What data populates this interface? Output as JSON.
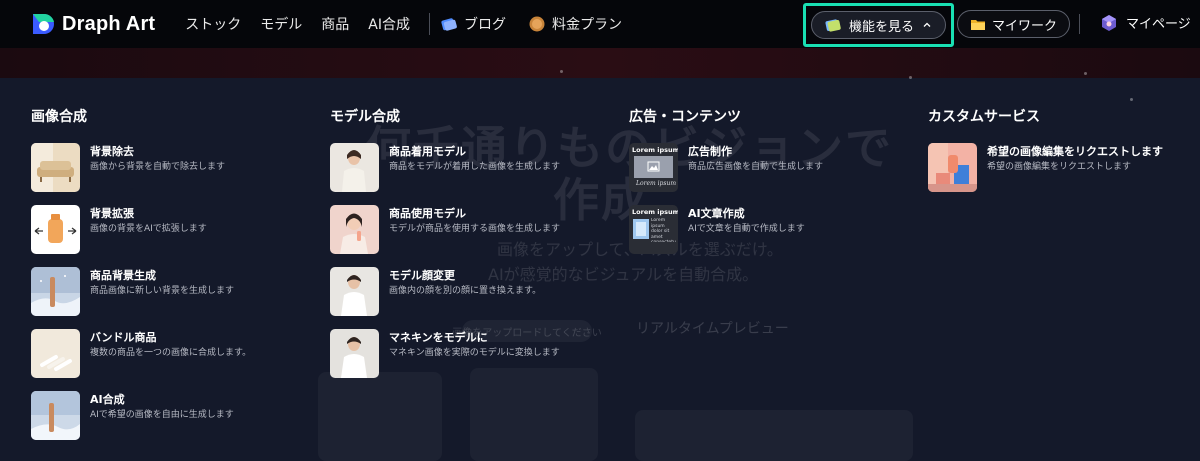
{
  "brand": {
    "name": "Draph Art",
    "accent": "#19e0b3"
  },
  "nav": {
    "links": [
      "ストック",
      "モデル",
      "商品",
      "AI合成"
    ],
    "blog": "ブログ",
    "pricing": "料金プラン",
    "features_label": "機能を見る",
    "mywork_label": "マイワーク",
    "mypage_label": "マイページ"
  },
  "hero": {
    "title_line1": "何千通りものビジョンで",
    "title_line2": "作成",
    "sub_line1": "画像をアップして、パズルを選ぶだけ。",
    "sub_line2": "AIが感覚的なビジュアルを自動合成。",
    "upload_hint": "画像をアップロードしてください",
    "preview_label": "リアルタイムプレビュー"
  },
  "menu": {
    "columns": [
      {
        "title": "画像合成",
        "items": [
          {
            "title": "背景除去",
            "desc": "画像から背景を自動で除去します",
            "icon": "sofa-thumbnail"
          },
          {
            "title": "背景拡張",
            "desc": "画像の背景をAIで拡張します",
            "icon": "bottle-expand-thumbnail"
          },
          {
            "title": "商品背景生成",
            "desc": "商品画像に新しい背景を生成します",
            "icon": "winter-product-thumbnail"
          },
          {
            "title": "バンドル商品",
            "desc": "複数の商品を一つの画像に合成します。",
            "icon": "bundle-thumbnail"
          },
          {
            "title": "AI合成",
            "desc": "AIで希望の画像を自由に生成します",
            "icon": "ai-composite-thumbnail"
          }
        ]
      },
      {
        "title": "モデル合成",
        "items": [
          {
            "title": "商品着用モデル",
            "desc": "商品をモデルが着用した画像を生成します",
            "icon": "model-wearing-thumbnail"
          },
          {
            "title": "商品使用モデル",
            "desc": "モデルが商品を使用する画像を生成します",
            "icon": "model-using-thumbnail"
          },
          {
            "title": "モデル顔変更",
            "desc": "画像内の顔を別の顔に置き換えます。",
            "icon": "face-swap-thumbnail"
          },
          {
            "title": "マネキンをモデルに",
            "desc": "マネキン画像を実際のモデルに変換します",
            "icon": "mannequin-thumbnail"
          }
        ]
      },
      {
        "title": "広告・コンテンツ",
        "items": [
          {
            "title": "広告制作",
            "desc": "商品広告画像を自動で生成します",
            "icon": "ad-thumbnail",
            "thumb_heading": "Lorem ipsum",
            "thumb_script": "Lorem ipsum"
          },
          {
            "title": "AI文章作成",
            "desc": "AIで文章を自動で作成します",
            "icon": "copywriting-thumbnail",
            "thumb_heading": "Lorem ipsum",
            "thumb_body": "Lorem ipsum dolor sit amet consectetur adipiscing elit"
          }
        ]
      },
      {
        "title": "カスタムサービス",
        "items": [
          {
            "title": "希望の画像編集をリクエストします",
            "desc": "希望の画像編集をリクエストします",
            "icon": "custom-service-thumbnail"
          }
        ]
      }
    ]
  }
}
